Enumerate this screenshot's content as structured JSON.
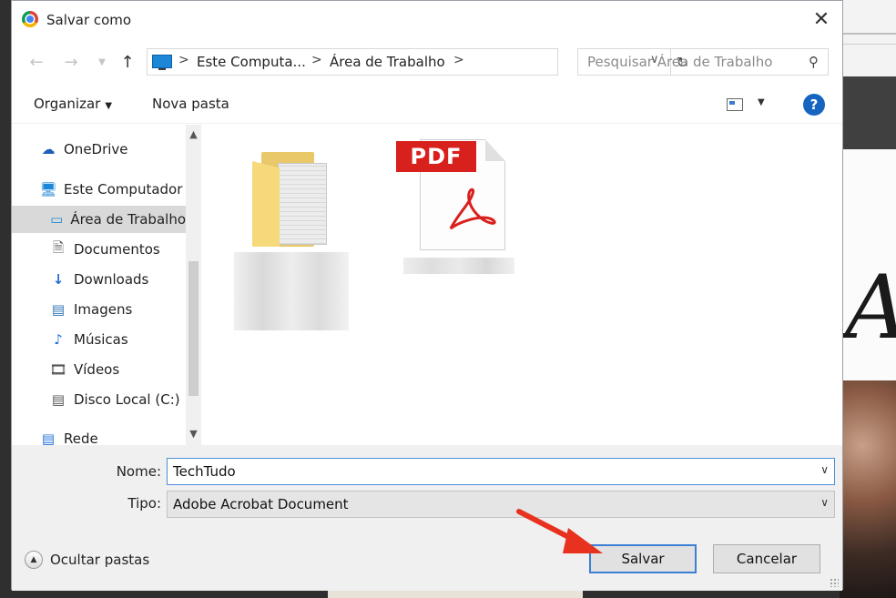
{
  "dialog": {
    "title": "Salvar como",
    "close_glyph": "✕"
  },
  "nav": {
    "back_icon": "back-arrow-icon",
    "forward_icon": "forward-arrow-icon",
    "up_icon": "up-arrow-icon",
    "breadcrumbs": [
      "Este Computa...",
      "Área de Trabalho"
    ],
    "separator": ">",
    "search_placeholder": "Pesquisar Área de Trabalho"
  },
  "toolbar": {
    "organize_label": "Organizar",
    "new_folder_label": "Nova pasta",
    "help_label": "?"
  },
  "sidebar": {
    "items": [
      {
        "label": "OneDrive",
        "icon": "cloud-icon"
      },
      {
        "label": "Este Computador",
        "icon": "computer-icon"
      },
      {
        "label": "Área de Trabalho",
        "icon": "desktop-icon",
        "selected": true
      },
      {
        "label": "Documentos",
        "icon": "document-icon"
      },
      {
        "label": "Downloads",
        "icon": "download-arrow-icon"
      },
      {
        "label": "Imagens",
        "icon": "image-icon"
      },
      {
        "label": "Músicas",
        "icon": "music-note-icon"
      },
      {
        "label": "Vídeos",
        "icon": "film-icon"
      },
      {
        "label": "Disco Local (C:)",
        "icon": "drive-icon"
      },
      {
        "label": "Rede",
        "icon": "network-icon"
      }
    ]
  },
  "files": {
    "folder_icon": "folder-icon",
    "pdf_icon": "pdf-file-icon",
    "pdf_badge": "PDF"
  },
  "form": {
    "name_label": "Nome:",
    "name_value": "TechTudo",
    "type_label": "Tipo:",
    "type_value": "Adobe Acrobat Document",
    "hide_folders_label": "Ocultar pastas",
    "save_label": "Salvar",
    "cancel_label": "Cancelar"
  },
  "colors": {
    "accent": "#1565c0",
    "annotation": "#e8321f",
    "pdf_red": "#d8201d",
    "folder_yellow": "#f5d97a"
  }
}
